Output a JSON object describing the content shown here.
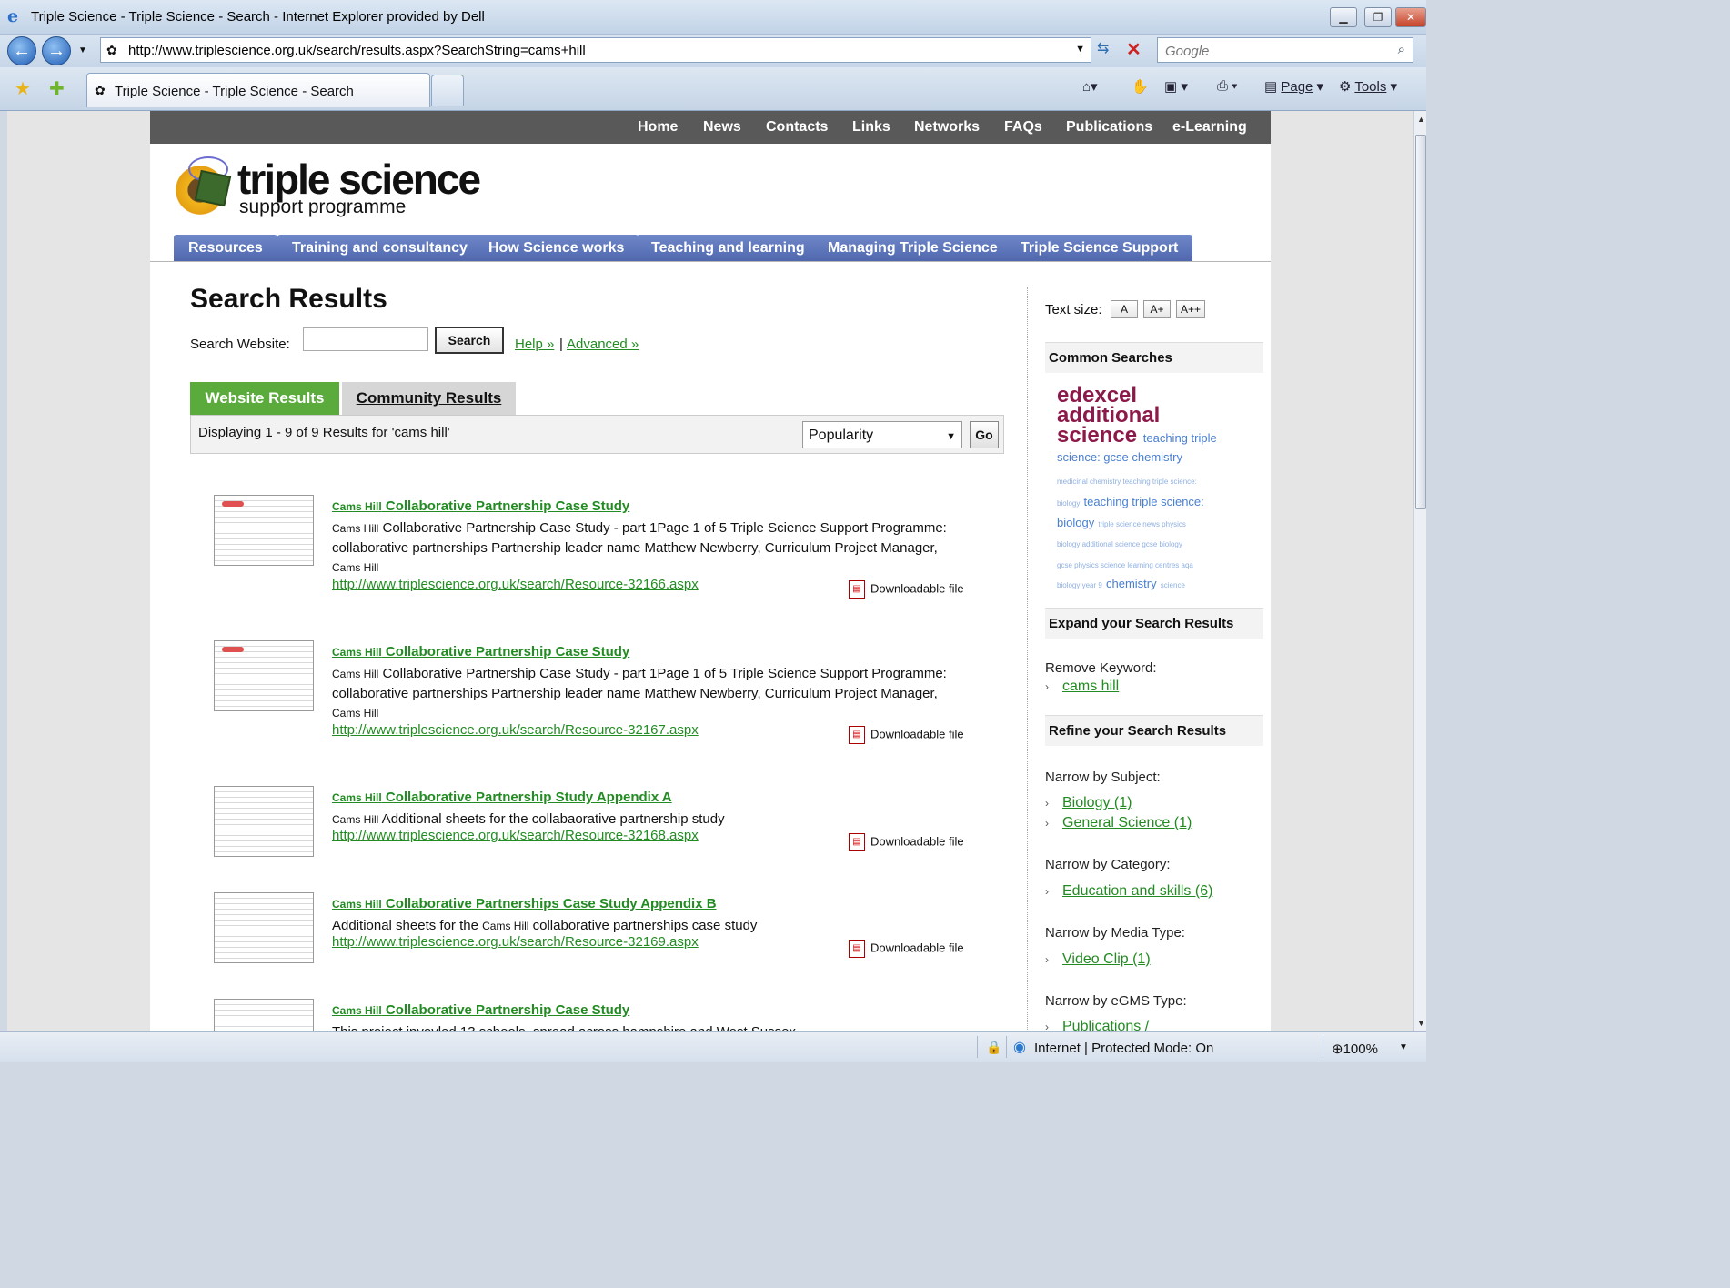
{
  "browser": {
    "title": "Triple Science - Triple Science - Search - Internet Explorer provided by Dell",
    "url": "http://www.triplescience.org.uk/search/results.aspx?SearchString=cams+hill",
    "search_placeholder": "Google",
    "tab_label": "Triple Science - Triple Science - Search",
    "page_menu": "Page",
    "tools_menu": "Tools",
    "status_zone": "Internet | Protected Mode: On",
    "zoom": "100%"
  },
  "topnav": [
    "Home",
    "News",
    "Contacts",
    "Links",
    "Networks",
    "FAQs",
    "Publications",
    "e-Learning"
  ],
  "brand": {
    "name": "triple science",
    "sub": "support programme"
  },
  "mainnav": [
    "Resources",
    "Training and consultancy",
    "How Science works",
    "Teaching and learning",
    "Managing Triple Science",
    "Triple Science Support"
  ],
  "search": {
    "heading": "Search Results",
    "label": "Search Website:",
    "button": "Search",
    "help": "Help »",
    "sep": "|",
    "advanced": "Advanced »"
  },
  "tabs": {
    "website": "Website Results",
    "community": "Community Results"
  },
  "results_bar": {
    "summary": "Displaying 1 - 9 of 9 Results for 'cams hill'",
    "sort": "Popularity",
    "go": "Go"
  },
  "results": [
    {
      "title_hl": "Cams Hill",
      "title": " Collaborative Partnership Case Study",
      "snippet_hl": "Cams Hill",
      "snippet": " Collaborative Partnership Case Study - part 1Page 1 of 5 Triple Science Support Programme: collaborative partnerships Partnership leader name Matthew Newberry, Curriculum Project Manager,",
      "snippet_tail": "Cams Hill",
      "url": "http://www.triplescience.org.uk/search/Resource-32166.aspx",
      "download": "Downloadable file"
    },
    {
      "title_hl": "Cams Hill",
      "title": " Collaborative Partnership Case Study",
      "snippet_hl": "Cams Hill",
      "snippet": " Collaborative Partnership Case Study - part 1Page 1 of 5 Triple Science Support Programme: collaborative partnerships Partnership leader name Matthew Newberry, Curriculum Project Manager,",
      "snippet_tail": "Cams Hill",
      "url": "http://www.triplescience.org.uk/search/Resource-32167.aspx",
      "download": "Downloadable file"
    },
    {
      "title_hl": "Cams Hill",
      "title": " Collaborative Partnership Study Appendix A",
      "snippet_hl": "Cams Hill",
      "snippet": " Additional sheets for the collabaorative partnership study",
      "url": "http://www.triplescience.org.uk/search/Resource-32168.aspx",
      "download": "Downloadable file"
    },
    {
      "title_hl": "Cams Hill",
      "title": " Collaborative Partnerships Case Study Appendix B",
      "snippet_pre": "Additional sheets for the ",
      "snippet_hl": "Cams Hill",
      "snippet": " collaborative partnerships case study",
      "url": "http://www.triplescience.org.uk/search/Resource-32169.aspx",
      "download": "Downloadable file"
    },
    {
      "title_hl": "Cams Hill",
      "title": " Collaborative Partnership Case Study",
      "snippet": "This project invovled 13 schools, spread across hampshire and West Sussex"
    }
  ],
  "sidebar": {
    "text_size_label": "Text size:",
    "text_sizes": [
      "A",
      "A+",
      "A++"
    ],
    "common_searches": "Common Searches",
    "cloud_big": [
      "edexcel",
      "additional",
      "science"
    ],
    "cloud_mid1": "teaching triple",
    "cloud_mid2": "science:    gcse    chemistry",
    "cloud_small1": "medicinal chemistry teaching triple science:",
    "cloud_small2": "biology",
    "cloud_mid3": "teaching triple science:",
    "cloud_mid4": "biology",
    "cloud_small3": "triple science news physics",
    "cloud_small4": "biology additional science gcse biology",
    "cloud_small5": "gcse physics science learning centres aqa",
    "cloud_small6": "biology year 9",
    "cloud_mid5": "chemistry",
    "cloud_small7": "science",
    "expand": "Expand your Search Results",
    "remove_kw": "Remove Keyword:",
    "kw": "cams hill",
    "refine": "Refine your Search Results",
    "subject_lbl": "Narrow by Subject:",
    "subjects": [
      "Biology (1)",
      "General Science (1)"
    ],
    "category_lbl": "Narrow by Category:",
    "categories": [
      "Education and skills (6)"
    ],
    "media_lbl": "Narrow by Media Type:",
    "media": [
      "Video Clip (1)"
    ],
    "egms_lbl": "Narrow by eGMS Type:",
    "egms": [
      "Publications /"
    ]
  }
}
